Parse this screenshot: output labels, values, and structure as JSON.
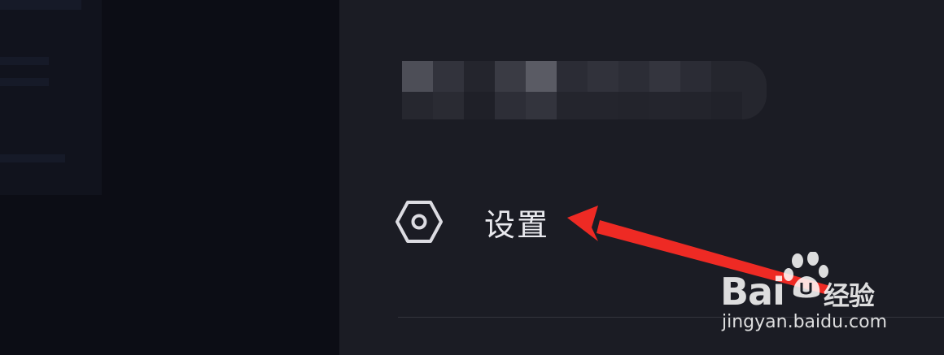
{
  "menu": {
    "settings_label": "设置",
    "settings_icon": "settings-hex-icon"
  },
  "watermark": {
    "logo_text": "Bai",
    "logo_suffix": "经验",
    "domain": "jingyan.baidu.com"
  },
  "colors": {
    "panel_bg": "#1b1c24",
    "left_bg": "#0c0d15",
    "text": "#e9e9ee",
    "arrow": "#ee2a24"
  }
}
